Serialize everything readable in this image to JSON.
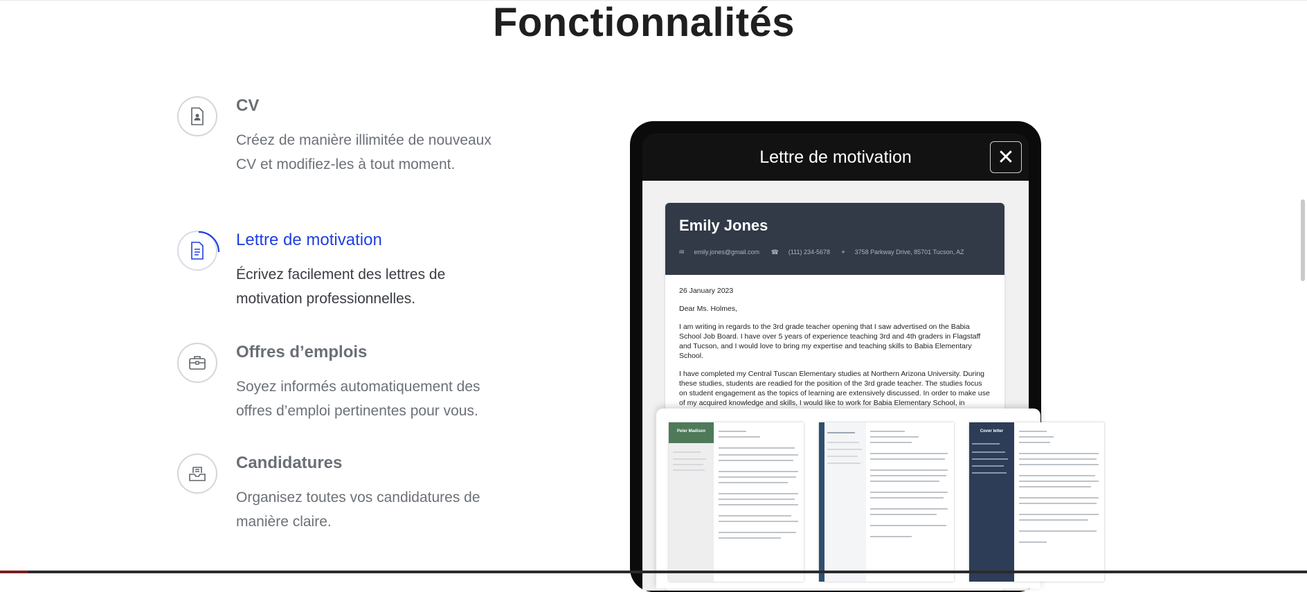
{
  "page": {
    "heading": "Fonctionnalités"
  },
  "features": [
    {
      "title": "CV",
      "description": "Créez de manière illimitée de nouveaux CV et modifiez-les à tout moment.",
      "icon": "cv-document-icon",
      "active": false
    },
    {
      "title": "Lettre de motivation",
      "description": "Écrivez facilement des lettres de motivation professionnelles.",
      "icon": "letter-document-icon",
      "active": true
    },
    {
      "title": "Offres d’emplois",
      "description": "Soyez informés automatiquement des offres d’emploi pertinentes pour vous.",
      "icon": "briefcase-icon",
      "active": false
    },
    {
      "title": "Candidatures",
      "description": "Organisez toutes vos candidatures de manière claire.",
      "icon": "inbox-tray-icon",
      "active": false
    }
  ],
  "modal": {
    "title": "Lettre de motivation",
    "close_symbol": "✕"
  },
  "letter": {
    "name": "Emily Jones",
    "email": "emily.jones@gmail.com",
    "phone": "(111) 234-5678",
    "address": "3758 Parkway Drive, 85701 Tucson, AZ",
    "date": "26 January 2023",
    "salutation": "Dear Ms. Holmes,",
    "paragraph_1": "I am writing in regards to the 3rd grade teacher opening that I saw advertised on the Babia School Job Board. I have over 5 years of experience teaching 3rd and 4th graders in Flagstaff and Tucson, and I would love to bring my expertise and teaching skills to Babia Elementary School.",
    "paragraph_2": "I have completed my Central Tuscan Elementary studies at Northern Arizona University. During these studies, students are readied for the position of the 3rd grade teacher. The studies focus on student engagement as the topics of learning are extensively discussed. In order to make use of my acquired knowledge and skills, I would like to work for Babia Elementary School, in"
  },
  "templates": [
    {
      "sidebar_title": "Peter Madison",
      "sidebar_color": "#4e7a5a"
    },
    {
      "sidebar_title": "",
      "sidebar_color": "#2f4f6d"
    },
    {
      "sidebar_title": "Cover letter",
      "sidebar_color": "#2d3d57"
    }
  ],
  "colors": {
    "accent": "#1f3fe0",
    "letter_header": "#323a48"
  }
}
